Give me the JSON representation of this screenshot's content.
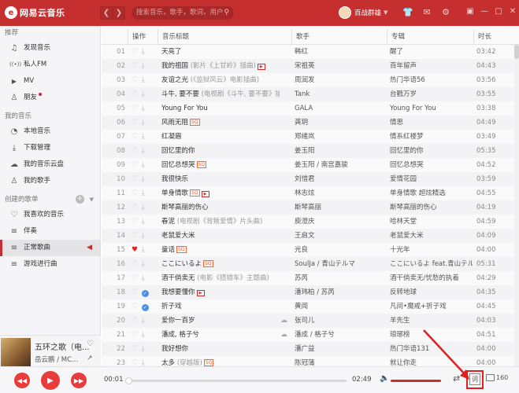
{
  "app": {
    "logo_glyph": "e",
    "logo_text": "网易云音乐"
  },
  "header": {
    "search_placeholder": "搜索音乐，歌手，歌词，用户",
    "user_name": "百战群雄",
    "icons": [
      "skin-icon",
      "mail-icon",
      "settings-icon"
    ],
    "window_icons": [
      "mini-mode-icon",
      "minimize-icon",
      "maximize-icon",
      "close-icon"
    ]
  },
  "sidebar": {
    "recommend_title": "推荐",
    "recommend": [
      {
        "label": "发现音乐",
        "icon": "♫"
      },
      {
        "label": "私人FM",
        "icon": "((•))"
      },
      {
        "label": "MV",
        "icon": "▶"
      },
      {
        "label": "朋友",
        "icon": "♙"
      }
    ],
    "my_music_title": "我的音乐",
    "my_music": [
      {
        "label": "本地音乐",
        "icon": "◔"
      },
      {
        "label": "下载管理",
        "icon": "⤓"
      },
      {
        "label": "我的音乐云盘",
        "icon": "☁"
      },
      {
        "label": "我的歌手",
        "icon": "♙"
      }
    ],
    "playlists_title": "创建的歌单",
    "playlists": [
      {
        "label": "我喜欢的音乐",
        "icon": "♡"
      },
      {
        "label": "伴奏",
        "icon": "≡"
      },
      {
        "label": "正常歌曲",
        "icon": "≡"
      },
      {
        "label": "游戏进行曲",
        "icon": "≡"
      }
    ]
  },
  "now_playing": {
    "title": "五环之歌（电...",
    "artist": "岳云鹏 / MC..."
  },
  "table": {
    "headers": {
      "ops": "操作",
      "title": "音乐标题",
      "artist": "歌手",
      "album": "专辑",
      "time": "时长"
    },
    "rows": [
      {
        "num": "01",
        "title": "天亮了",
        "alias": "",
        "tags": [],
        "artist": "韩红",
        "album": "醒了",
        "time": "03:42"
      },
      {
        "num": "02",
        "title": "我的祖国",
        "alias": "(影片《上甘岭》插曲)",
        "tags": [
          "mv"
        ],
        "artist": "宋祖英",
        "album": "百年留声",
        "time": "04:43"
      },
      {
        "num": "03",
        "title": "友谊之光",
        "alias": "(《监狱风云》电影插曲)",
        "tags": [],
        "artist": "周润发",
        "album": "热门华语56",
        "time": "03:56"
      },
      {
        "num": "04",
        "title": "斗牛, 要不要",
        "alias": "(电视剧《斗牛, 要不要》插曲)",
        "tags": [],
        "artist": "Tank",
        "album": "台戳万岁",
        "time": "03:55"
      },
      {
        "num": "05",
        "title": "Young For You",
        "alias": "",
        "tags": [],
        "artist": "GALA",
        "album": "Young For You",
        "time": "03:38"
      },
      {
        "num": "06",
        "title": "风雨无阻",
        "alias": "",
        "tags": [
          "sq"
        ],
        "artist": "龚玥",
        "album": "情思",
        "time": "04:49"
      },
      {
        "num": "07",
        "title": "红凝眉",
        "alias": "",
        "tags": [],
        "artist": "郑绪岚",
        "album": "情系红楼梦",
        "time": "03:49"
      },
      {
        "num": "08",
        "title": "回忆里的你",
        "alias": "",
        "tags": [],
        "artist": "姜玉阳",
        "album": "回忆里的你",
        "time": "05:35"
      },
      {
        "num": "09",
        "title": "回忆总想哭",
        "alias": "",
        "tags": [
          "sq"
        ],
        "artist": "姜玉阳 / 南宫嘉骏",
        "album": "回忆总想哭",
        "time": "04:52"
      },
      {
        "num": "10",
        "title": "我很快乐",
        "alias": "",
        "tags": [],
        "artist": "刘惜君",
        "album": "爱情花园",
        "time": "03:59"
      },
      {
        "num": "11",
        "title": "单身情歌",
        "alias": "",
        "tags": [
          "sq",
          "mv"
        ],
        "artist": "林志炫",
        "album": "单身情歌 超炫精选",
        "time": "04:55"
      },
      {
        "num": "12",
        "title": "斯琴高丽的伤心",
        "alias": "",
        "tags": [],
        "artist": "斯琴高丽",
        "album": "斯琴高丽的伤心",
        "time": "04:19"
      },
      {
        "num": "13",
        "title": "春泥",
        "alias": "(电视剧《背叛爱情》片头曲)",
        "tags": [],
        "artist": "庾澄庆",
        "album": "哈林天堂",
        "time": "04:59"
      },
      {
        "num": "14",
        "title": "老鼠爱大米",
        "alias": "",
        "tags": [],
        "artist": "王启文",
        "album": "老鼠爱大米",
        "time": "04:09"
      },
      {
        "num": "15",
        "title": "童话",
        "alias": "",
        "tags": [
          "sq"
        ],
        "artist": "光良",
        "album": "十光年",
        "time": "04:00",
        "liked": true
      },
      {
        "num": "16",
        "title": "ここにいるよ",
        "alias": "",
        "tags": [
          "sq"
        ],
        "artist": "SoulJa / 青山テルマ",
        "album": "ここにいるよ feat.青山テル",
        "time": "05:31"
      },
      {
        "num": "17",
        "title": "酒干倘卖无",
        "alias": "(电影《搭错车》主题曲)",
        "tags": [],
        "artist": "苏芮",
        "album": "酒干倘卖无/忧愁的执着",
        "time": "04:29"
      },
      {
        "num": "18",
        "title": "我想要懂你",
        "alias": "",
        "tags": [
          "mv"
        ],
        "artist": "潘玮柏 / 苏芮",
        "album": "反转地球",
        "time": "04:35",
        "checked": true
      },
      {
        "num": "19",
        "title": "折子戏",
        "alias": "",
        "tags": [],
        "artist": "黄阅",
        "album": "凡间•魔戒+折子戏",
        "time": "04:45",
        "checked": true
      },
      {
        "num": "20",
        "title": "爱你一百岁",
        "alias": "",
        "tags": [],
        "artist": "张司儿",
        "album": "羊先生",
        "time": "04:03",
        "cloud": true
      },
      {
        "num": "21",
        "title": "潘成, 格子兮",
        "alias": "",
        "tags": [],
        "artist": "潘成 / 格子兮",
        "album": "琅琊榜",
        "time": "04:51",
        "cloud": true
      },
      {
        "num": "22",
        "title": "我好想你",
        "alias": "",
        "tags": [],
        "artist": "潘广益",
        "album": "热门华语131",
        "time": "04:00"
      },
      {
        "num": "23",
        "title": "太多",
        "alias": "(穿越版)",
        "tags": [
          "sq"
        ],
        "artist": "陈冠蒲",
        "album": "就让你走",
        "time": "04:00"
      }
    ]
  },
  "player": {
    "current_time": "00:01",
    "total_time": "02:49",
    "progress": 0.01,
    "volume": 1.0,
    "lyric_label": "词",
    "playlist_count": "160"
  },
  "colors": {
    "brand": "#c62f2f",
    "highlight": "#e02020"
  }
}
